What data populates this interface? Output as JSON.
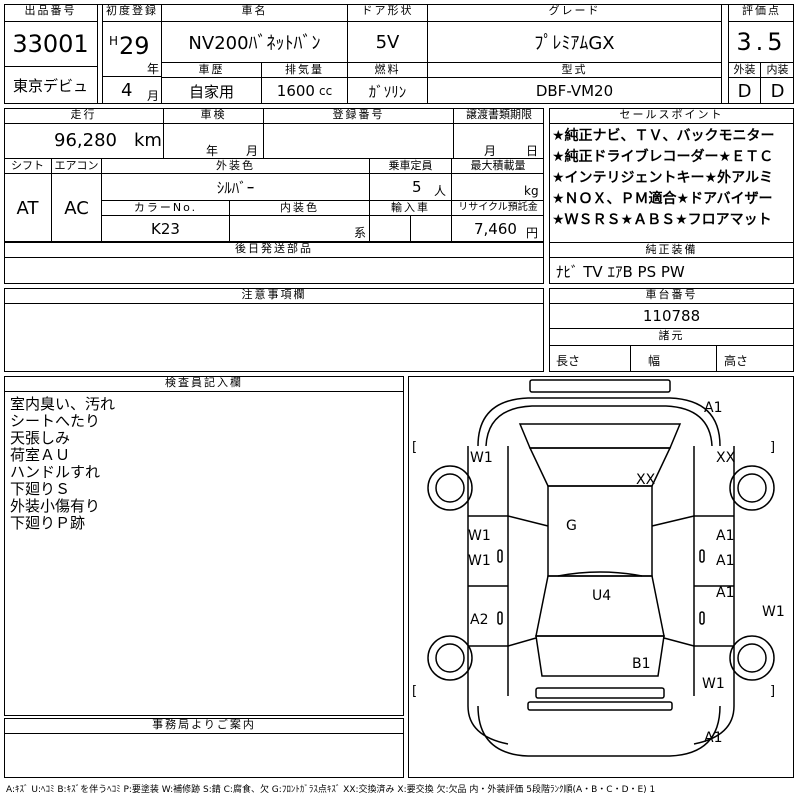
{
  "header": {
    "lot_no_label": "出品番号",
    "lot_no": "33001",
    "first_reg_label": "初度登録",
    "era": "H",
    "year_val": "29",
    "year_unit": "年",
    "month_val": "4",
    "month_unit": "月",
    "car_name_label": "車名",
    "car_name": "NV200ﾊﾞﾈｯﾄﾊﾞﾝ",
    "door_label": "ドア形状",
    "door": "5V",
    "grade_label": "グレード",
    "grade": "ﾌﾟﾚﾐｱﾑGX",
    "score_label": "評価点",
    "score": "3.5",
    "ext_label": "外装",
    "ext": "D",
    "int_label": "内装",
    "int": "D",
    "history_label": "車歴",
    "history": "自家用",
    "disp_label": "排気量",
    "disp": "1600",
    "disp_unit": "cc",
    "fuel_label": "燃料",
    "fuel": "ｶﾞｿﾘﾝ",
    "model_label": "型式",
    "model": "DBF-VM20",
    "venue": "東京デビュ"
  },
  "row2": {
    "mileage_label": "走行",
    "mileage": "96,280",
    "mileage_unit": "km",
    "inspection_label": "車検",
    "insp_year_unit": "年",
    "insp_month_unit": "月",
    "reg_no_label": "登録番号",
    "transfer_label": "譲渡書類期限",
    "transfer_month_unit": "月",
    "transfer_day_unit": "日",
    "shift_label": "シフト",
    "shift": "AT",
    "ac_label": "エアコン",
    "ac": "AC",
    "ext_color_label": "外装色",
    "ext_color": "ｼﾙﾊﾞｰ",
    "capacity_label": "乗車定員",
    "capacity": "5",
    "capacity_unit": "人",
    "load_label": "最大積載量",
    "load_unit": "kg",
    "color_no_label": "カラーNo.",
    "color_no": "K23",
    "int_color_label": "内装色",
    "int_color_unit": "系",
    "import_label": "輸入車",
    "recycle_label": "リサイクル預託金",
    "recycle": "7,460",
    "recycle_unit": "円",
    "later_parts_label": "後日発送部品"
  },
  "sales_points": {
    "label": "セールスポイント",
    "lines": [
      "★純正ナビ、ＴＶ、バックモニター",
      "★純正ドライブレコーダー★ＥＴＣ",
      "★インテリジェントキー★外アルミ",
      "★ＮＯＸ、ＰＭ適合★ドアバイザー",
      "★ＷＳＲＳ★ＡＢＳ★フロアマット"
    ]
  },
  "equipment": {
    "label": "純正装備",
    "value": "ﾅﾋﾞ TV ｴｱB PS PW"
  },
  "notes": {
    "label": "注意事項欄"
  },
  "chassis": {
    "label": "車台番号",
    "value": "110788"
  },
  "dims": {
    "label": "諸元",
    "length": "長さ",
    "width": "幅",
    "height": "高さ"
  },
  "inspector": {
    "label": "検査員記入欄",
    "lines": [
      "室内臭い、汚れ",
      "シートへたり",
      "天張しみ",
      "荷室ＡＵ",
      "ハンドルすれ",
      "下廻りＳ",
      "外装小傷有り",
      "下廻りＰ跡"
    ]
  },
  "office": {
    "label": "事務局よりご案内"
  },
  "diagram": {
    "marks": [
      "A1",
      "W1",
      "XX",
      "XX",
      "G",
      "W1",
      "A1",
      "W1",
      "A1",
      "U4",
      "A1",
      "W1",
      "A2",
      "B1",
      "W1",
      "A1"
    ],
    "bracket_open": "[",
    "bracket_close": "]"
  },
  "legend": "A:ｷｽﾞ U:ﾍｺﾐ B:ｷｽﾞを伴うﾍｺﾐ P:要塗装 W:補修跡 S:錆 C:腐食、欠 G:ﾌﾛﾝﾄｶﾞﾗｽ点ｷｽﾞ XX:交換済み X:要交換 欠:欠品 内・外装評価 5段階ﾗﾝｸ順(A・B・C・D・E) 1"
}
